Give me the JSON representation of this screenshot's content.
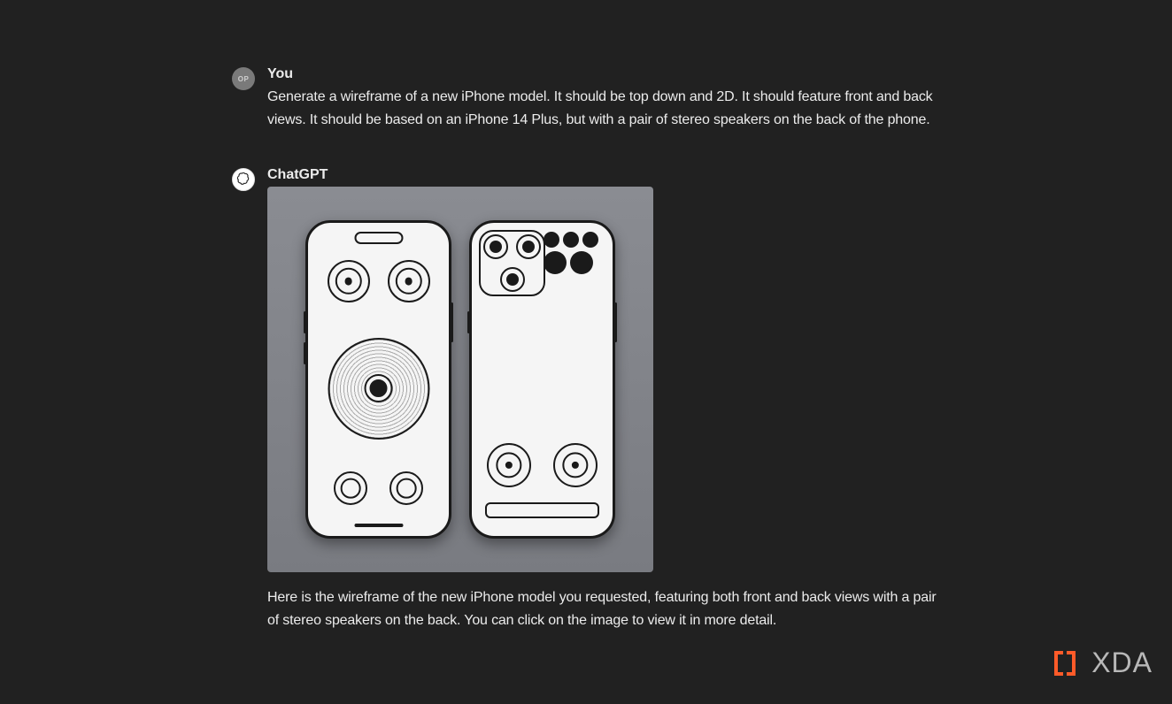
{
  "messages": [
    {
      "sender": "You",
      "avatar_label": "OP",
      "text": "Generate a wireframe of a new iPhone model.  It should be top down and 2D. It should feature front and back views. It should be based on an iPhone 14 Plus, but with a pair of stereo speakers on the back of the phone."
    },
    {
      "sender": "ChatGPT",
      "text": "Here is the wireframe of the new iPhone model you requested, featuring both front and back views with a pair of stereo speakers on the back. You can click on the image to view it in more detail."
    }
  ],
  "watermark": {
    "text": "XDA"
  }
}
